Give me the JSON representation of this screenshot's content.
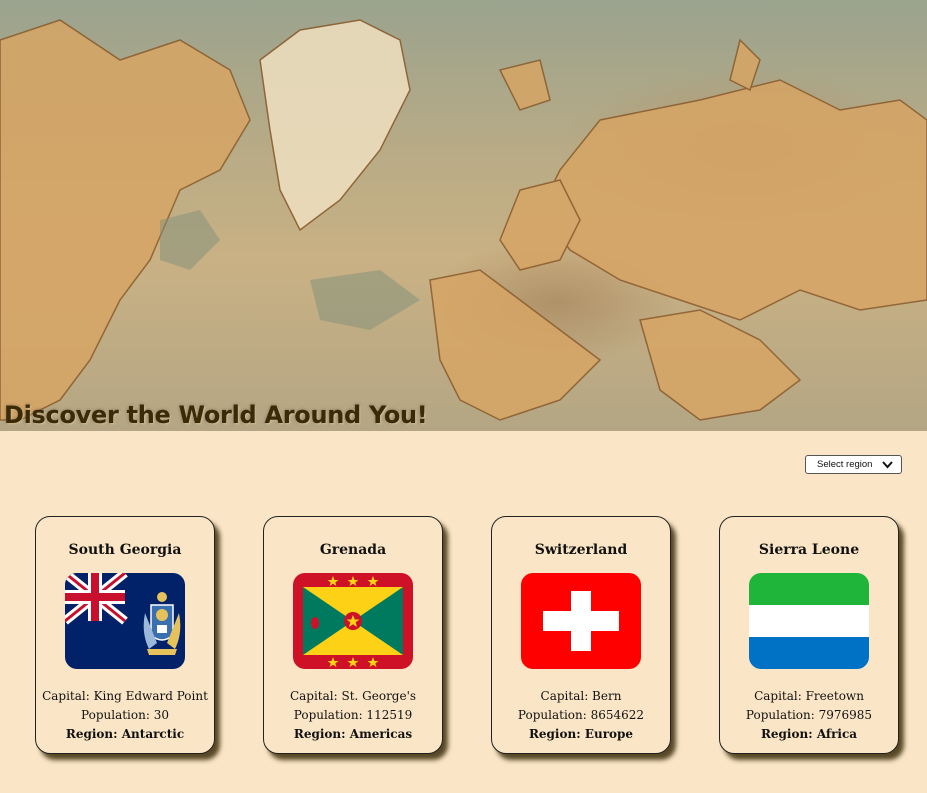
{
  "header": {
    "title": "Discover the World Around You!"
  },
  "filter": {
    "label": "Select region"
  },
  "cards": [
    {
      "name": "South Georgia",
      "capital": "Capital: King Edward Point",
      "population": "Population: 30",
      "region": "Region: Antarctic",
      "flag": "south-georgia-flag"
    },
    {
      "name": "Grenada",
      "capital": "Capital: St. George's",
      "population": "Population: 112519",
      "region": "Region: Americas",
      "flag": "grenada-flag"
    },
    {
      "name": "Switzerland",
      "capital": "Capital: Bern",
      "population": "Population: 8654622",
      "region": "Region: Europe",
      "flag": "switzerland-flag"
    },
    {
      "name": "Sierra Leone",
      "capital": "Capital: Freetown",
      "population": "Population: 7976985",
      "region": "Region: Africa",
      "flag": "sierra-leone-flag"
    }
  ],
  "colors": {
    "background": "#fae6c6",
    "title": "#3a2a08"
  }
}
